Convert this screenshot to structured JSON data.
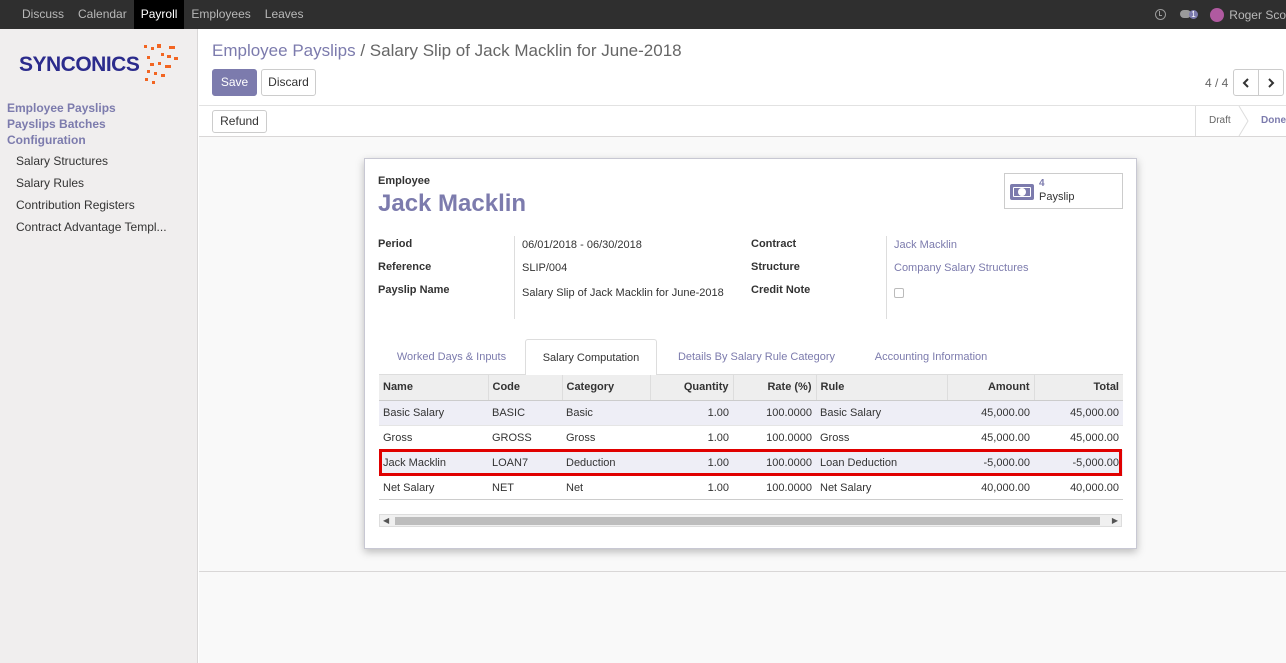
{
  "topbar": {
    "menu": [
      "Discuss",
      "Calendar",
      "Payroll",
      "Employees",
      "Leaves"
    ],
    "active": "Payroll",
    "chat_count": "1",
    "user": "Roger Sco"
  },
  "sidebar": {
    "logo_text": "SYNCONICS",
    "sections": [
      {
        "label": "Employee Payslips"
      },
      {
        "label": "Payslips Batches"
      },
      {
        "label": "Configuration"
      }
    ],
    "items": [
      "Salary Structures",
      "Salary Rules",
      "Contribution Registers",
      "Contract Advantage Templ..."
    ]
  },
  "control_panel": {
    "breadcrumb_root": "Employee Payslips",
    "breadcrumb_sep": " / ",
    "breadcrumb_current": "Salary Slip of Jack Macklin for June-2018",
    "save": "Save",
    "discard": "Discard",
    "pager": "4 / 4"
  },
  "statusbar": {
    "refund": "Refund",
    "stages": [
      "Draft",
      "Done"
    ],
    "active_stage": "Done"
  },
  "form": {
    "employee_label": "Employee",
    "employee_name": "Jack Macklin",
    "smart_button": {
      "count": "4",
      "label": "Payslip"
    },
    "left_fields": [
      {
        "label": "Period",
        "value": "06/01/2018 - 06/30/2018"
      },
      {
        "label": "Reference",
        "value": "SLIP/004"
      },
      {
        "label": "Payslip Name",
        "value": "Salary Slip of Jack Macklin for June-2018"
      }
    ],
    "right_fields": [
      {
        "label": "Contract",
        "value": "Jack Macklin"
      },
      {
        "label": "Structure",
        "value": "Company Salary Structures"
      },
      {
        "label": "Credit Note",
        "value": ""
      }
    ],
    "tabs": [
      "Worked Days & Inputs",
      "Salary Computation",
      "Details By Salary Rule Category",
      "Accounting Information"
    ],
    "active_tab": "Salary Computation",
    "table": {
      "headers": [
        "Name",
        "Code",
        "Category",
        "Quantity",
        "Rate (%)",
        "Rule",
        "Amount",
        "Total"
      ],
      "rows": [
        [
          "Basic Salary",
          "BASIC",
          "Basic",
          "1.00",
          "100.0000",
          "Basic Salary",
          "45,000.00",
          "45,000.00"
        ],
        [
          "Gross",
          "GROSS",
          "Gross",
          "1.00",
          "100.0000",
          "Gross",
          "45,000.00",
          "45,000.00"
        ],
        [
          "Jack Macklin",
          "LOAN7",
          "Deduction",
          "1.00",
          "100.0000",
          "Loan Deduction",
          "-5,000.00",
          "-5,000.00"
        ],
        [
          "Net Salary",
          "NET",
          "Net",
          "1.00",
          "100.0000",
          "Net Salary",
          "40,000.00",
          "40,000.00"
        ]
      ]
    }
  },
  "colors": {
    "accent": "#7c7bad",
    "highlight": "#e00000"
  }
}
